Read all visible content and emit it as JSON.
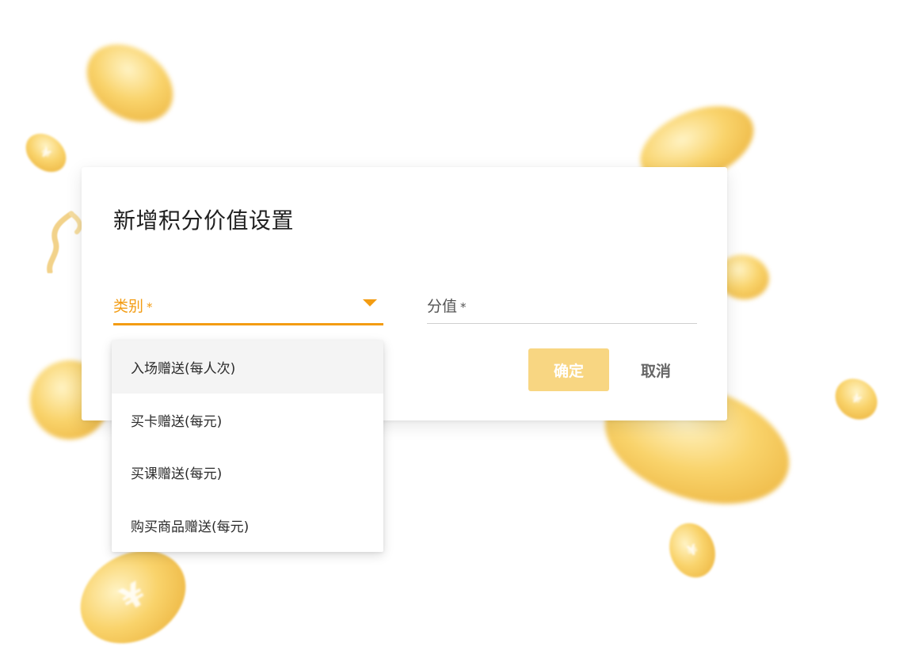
{
  "dialog": {
    "title": "新增积分价值设置",
    "category_field": {
      "label": "类别",
      "required_mark": "*"
    },
    "score_field": {
      "label": "分值",
      "required_mark": "*"
    },
    "confirm_label": "确定",
    "cancel_label": "取消"
  },
  "category_menu": {
    "items": [
      {
        "label": "入场赠送(每人次)",
        "active": true
      },
      {
        "label": "买卡赠送(每元)",
        "active": false
      },
      {
        "label": "买课赠送(每元)",
        "active": false
      },
      {
        "label": "购买商品赠送(每元)",
        "active": false
      }
    ]
  },
  "colors": {
    "accent": "#f39c12",
    "confirm_bg": "#f8d682",
    "coin": "#f9d36b"
  },
  "background": {
    "coin_mark": "¥"
  }
}
